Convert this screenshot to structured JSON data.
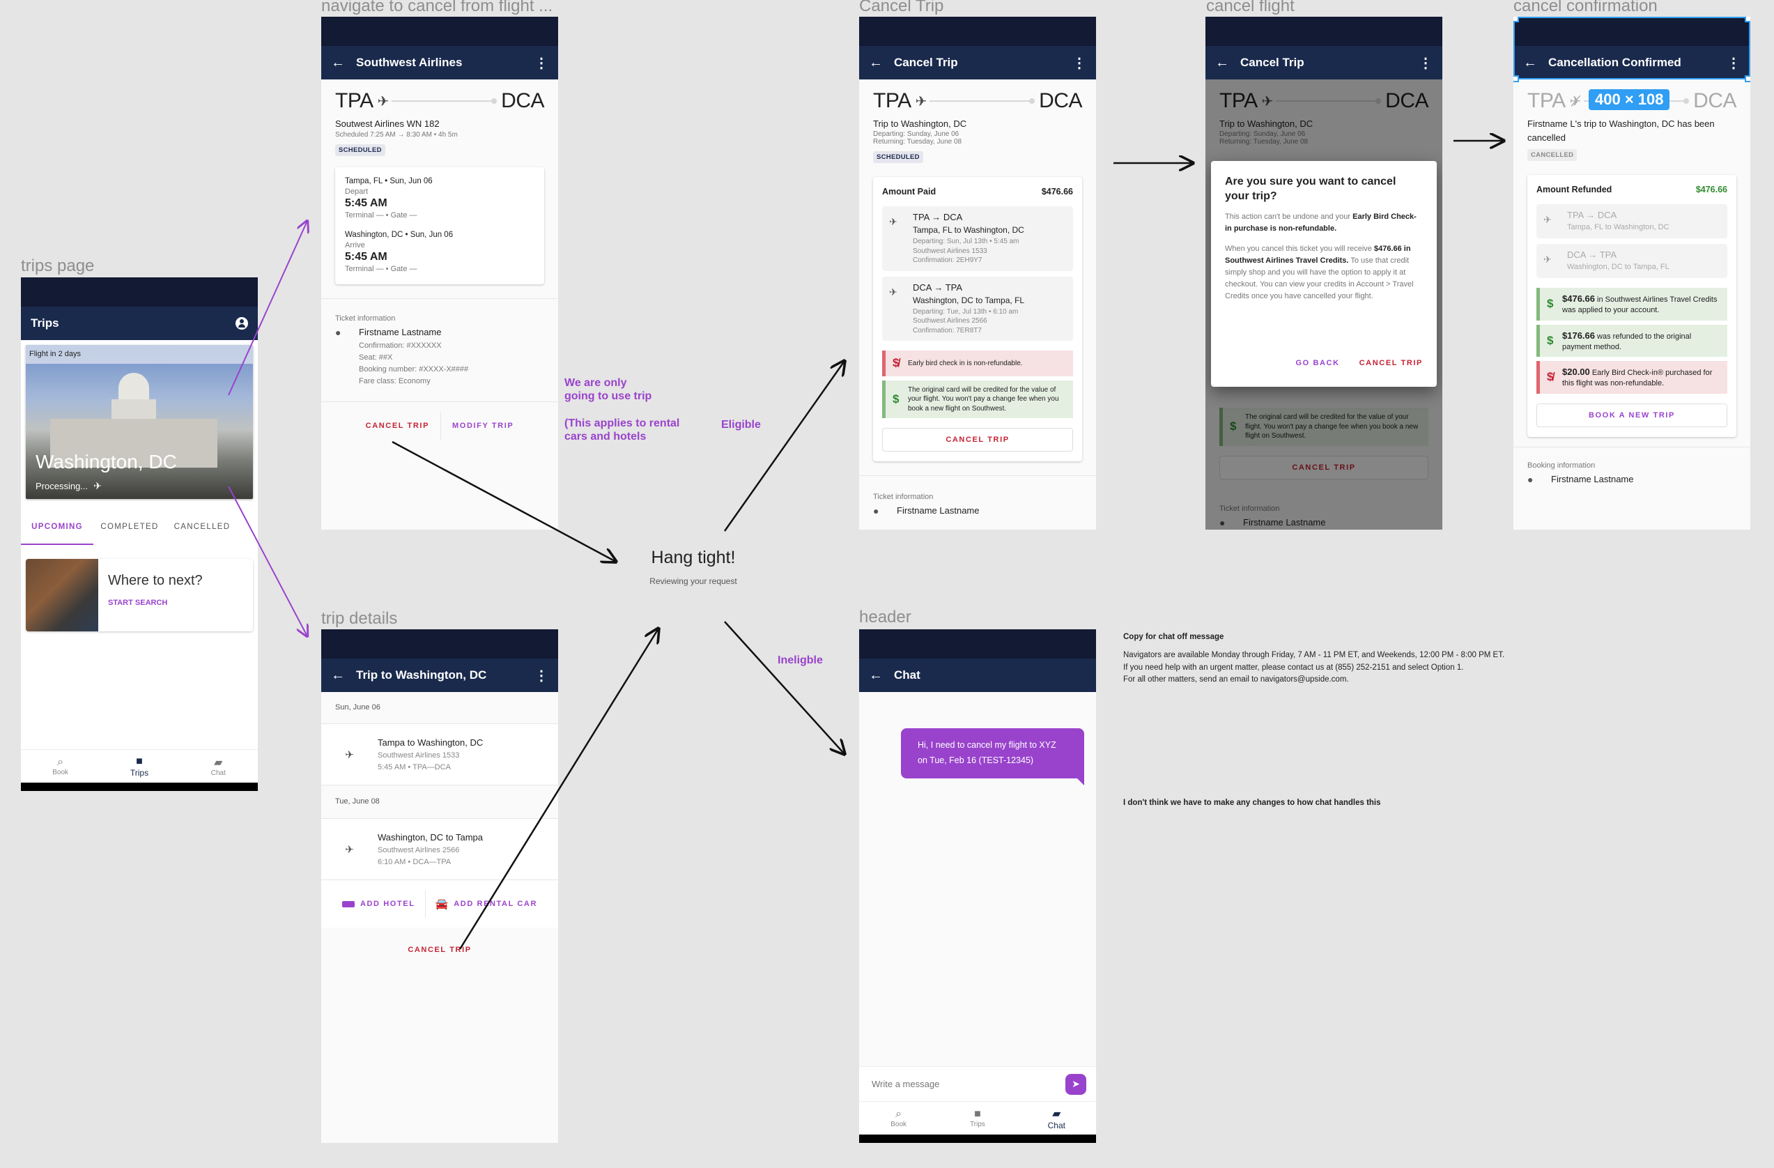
{
  "frame_labels": {
    "trips_page": "trips page",
    "flight_details": "navigate to cancel from flight ...",
    "trip_details": "trip details",
    "cancel_trip": "Cancel Trip",
    "cancel_flight": "cancel flight",
    "cancel_confirmation": "cancel confirmation",
    "chat": "header"
  },
  "trips_page": {
    "title": "Trips",
    "hero": {
      "tag": "Flight in 2 days",
      "city": "Washington, DC",
      "status": "Processing..."
    },
    "tabs": [
      {
        "label": "UPCOMING",
        "active": true
      },
      {
        "label": "COMPLETED",
        "active": false
      },
      {
        "label": "CANCELLED",
        "active": false
      }
    ],
    "promo": {
      "title": "Where to next?",
      "action": "START SEARCH"
    },
    "nav": [
      {
        "label": "Book",
        "icon": "search-icon"
      },
      {
        "label": "Trips",
        "icon": "briefcase-icon",
        "active": true
      },
      {
        "label": "Chat",
        "icon": "chat-icon"
      }
    ]
  },
  "flight_details": {
    "title": "Southwest Airlines",
    "origin": "TPA",
    "destination": "DCA",
    "flight_name": "Soutwest Airlines WN 182",
    "schedule": "Scheduled 7:25 AM  →  8:30 AM • 4h 5m",
    "badge": "SCHEDULED",
    "depart": {
      "place": "Tampa, FL • Sun, Jun 06",
      "label": "Depart",
      "time": "5:45 AM",
      "terminal": "Terminal — • Gate —"
    },
    "arrive": {
      "place": "Washington, DC • Sun, Jun 06",
      "label": "Arrive",
      "time": "5:45 AM",
      "terminal": "Terminal — • Gate —"
    },
    "ticket": {
      "heading": "Ticket information",
      "name": "Firstname Lastname",
      "lines": [
        "Confirmation: #XXXXXX",
        "Seat: ##X",
        "Booking number: #XXXX-X####",
        "Fare class: Economy"
      ]
    },
    "cancel_label": "CANCEL TRIP",
    "modify_label": "MODIFY TRIP"
  },
  "trip_details": {
    "title": "Trip to Washington, DC",
    "days": [
      {
        "date": "Sun, June 06",
        "item": {
          "title": "Tampa to Washington, DC",
          "airline": "Southwest Airlines 1533",
          "detail": "5:45 AM • TPA—DCA"
        }
      },
      {
        "date": "Tue, June 08",
        "item": {
          "title": "Washington, DC to Tampa",
          "airline": "Southwest Airlines 2566",
          "detail": "6:10 AM •  DCA—TPA"
        }
      }
    ],
    "add_hotel": "ADD HOTEL",
    "add_car": "ADD RENTAL CAR",
    "cancel_label": "CANCEL TRIP"
  },
  "notes": {
    "trip_only": "We are only\ngoing to use trip\n\n(This applies to rental\ncars and hotels",
    "eligible": "Eligible",
    "ineligible": "Ineligble"
  },
  "loading": {
    "title": "Hang tight!",
    "subtitle": "Reviewing your request"
  },
  "cancel_trip": {
    "title": "Cancel Trip",
    "origin": "TPA",
    "destination": "DCA",
    "trip_name": "Trip to Washington, DC",
    "departing": "Departing: Sunday, June 06",
    "returning": "Returning: Tuesday, June 08",
    "badge": "SCHEDULED",
    "amount_label": "Amount Paid",
    "amount": "$476.66",
    "legs": [
      {
        "route": "TPA → DCA",
        "cities": "Tampa, FL to Washington, DC",
        "details": [
          "Departing: Sun, Jul 13th • 5:45 am",
          "Southwest Airlines 1533",
          "Confirmation: 2EH9Y7"
        ]
      },
      {
        "route": "DCA → TPA",
        "cities": "Washington, DC to Tampa, FL",
        "details": [
          "Departing: Tue, Jul 13th • 6:10 am",
          "Southwest Airlines 2566",
          "Confirmation: 7ER8T7"
        ]
      }
    ],
    "warning": "Early bird check in is non-refundable.",
    "info": "The original card will be credited for the value of your flight. You won't pay a change fee when you book a new flight on Southwest.",
    "cancel_label": "CANCEL TRIP",
    "ticket_heading": "Ticket information",
    "ticket_name": "Firstname Lastname"
  },
  "cancel_dialog": {
    "title": "Are you sure you want to cancel your trip?",
    "p1_plain": "This action can't be undone and your ",
    "p1_bold": "Early Bird Check-in purchase is non-refundable.",
    "p2_plain1": "When you cancel this ticket you will receive ",
    "p2_bold": "$476.66 in Southwest Airlines Travel Credits.",
    "p2_plain2": " To use that credit simply shop and you will have the option to apply it at checkout. You can view your credits in Account > Travel Credits once you have cancelled your flight.",
    "go_back": "GO BACK",
    "confirm": "CANCEL TRIP"
  },
  "confirmation": {
    "title": "Cancellation Confirmed",
    "origin": "TPA",
    "destination": "DCA",
    "size_tag": "400 × 108",
    "message": "Firstname L's trip to Washington, DC has been cancelled",
    "badge": "CANCELLED",
    "amount_label": "Amount Refunded",
    "amount": "$476.66",
    "legs": [
      {
        "route": "TPA → DCA",
        "cities": "Tampa, FL to Washington, DC"
      },
      {
        "route": "DCA → TPA",
        "cities": "Washington, DC to Tampa, FL"
      }
    ],
    "credit_amount": "$476.66",
    "credit_text": " in Southwest Airlines Travel Credits was applied to your account.",
    "refund_amount": "$176.66",
    "refund_text": " was refunded to the original payment method.",
    "fee_amount": "$20.00",
    "fee_text": " Early Bird Check-in® purchased for this flight was non-refundable.",
    "book_label": "BOOK A NEW TRIP",
    "booking_heading": "Booking information",
    "booking_name": "Firstname Lastname"
  },
  "chat": {
    "title": "Chat",
    "message": "Hi, I need to cancel my flight to XYZ on Tue, Feb 16 (TEST-12345)",
    "input_placeholder": "Write a message",
    "nav": [
      {
        "label": "Book"
      },
      {
        "label": "Trips"
      },
      {
        "label": "Chat",
        "active": true
      }
    ]
  },
  "copy_note": {
    "heading": "Copy for chat off message",
    "lines": [
      "Navigators are available Monday through Friday, 7 AM - 11 PM ET, and Weekends, 12:00 PM - 8:00 PM ET.",
      "If you need help with an urgent matter, please contact us at (855) 252-2151 and select Option 1.",
      "For all other matters, send an email to navigators@upside.com."
    ]
  },
  "chat_note": "I don't think we have to make any changes to how chat handles this",
  "colors": {
    "accent": "#9943cc",
    "danger": "#c62233",
    "navy": "#1a2a4d",
    "statusbar": "#131a33",
    "success": "#2e8b2e"
  }
}
